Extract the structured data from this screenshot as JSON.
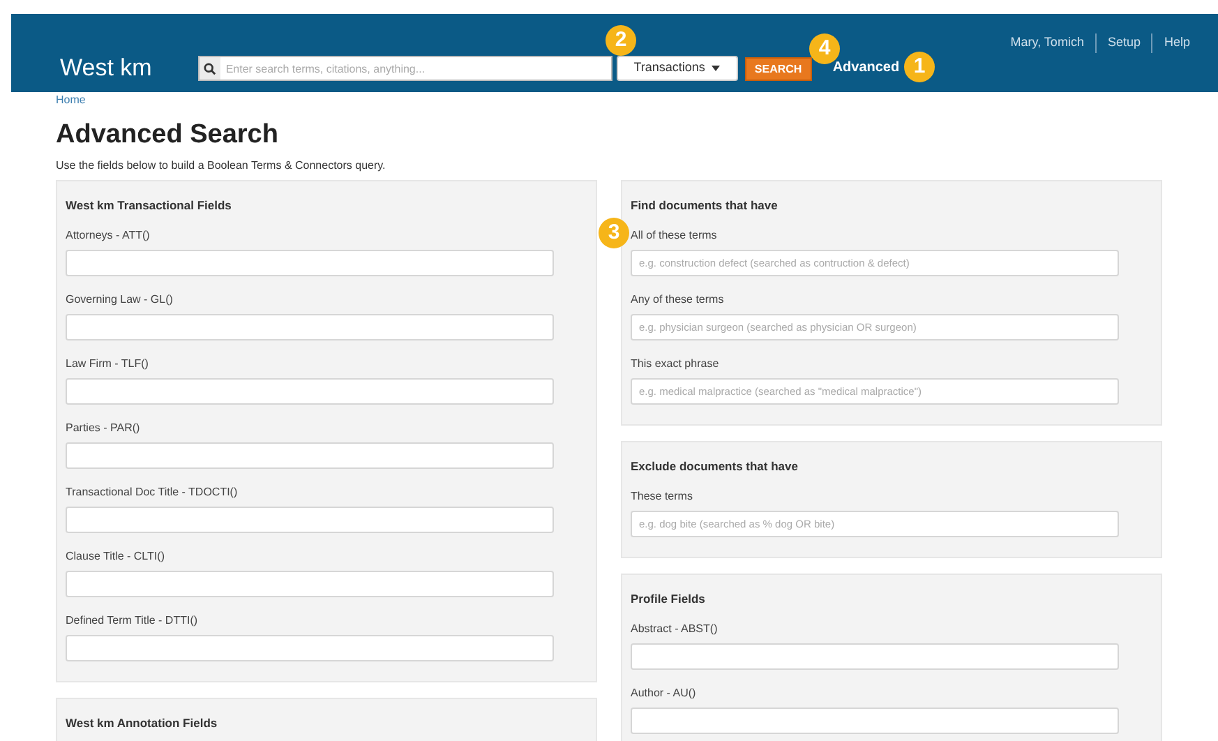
{
  "header": {
    "logo": "West km",
    "search": {
      "placeholder": "Enter search terms, citations, anything..."
    },
    "scope_button": "Transactions",
    "search_button": "SEARCH",
    "advanced_link": "Advanced",
    "user_links": [
      "Mary, Tomich",
      "Setup",
      "Help"
    ]
  },
  "breadcrumb": "Home",
  "title": "Advanced Search",
  "intro": "Use the fields below to build a Boolean Terms & Connectors query.",
  "left_panels": [
    {
      "heading": "West km Transactional Fields",
      "fields": [
        {
          "label": "Attorneys - ATT()"
        },
        {
          "label": "Governing Law - GL()"
        },
        {
          "label": "Law Firm - TLF()"
        },
        {
          "label": "Parties - PAR()"
        },
        {
          "label": "Transactional Doc Title - TDOCTI()"
        },
        {
          "label": "Clause Title - CLTI()"
        },
        {
          "label": "Defined Term Title - DTTI()"
        }
      ]
    },
    {
      "heading": "West km Annotation Fields"
    }
  ],
  "right_panels": [
    {
      "heading": "Find documents that have",
      "fields": [
        {
          "label": "All of these terms",
          "placeholder": "e.g. construction defect (searched as contruction & defect)"
        },
        {
          "label": "Any of these terms",
          "placeholder": "e.g. physician surgeon (searched as physician OR surgeon)"
        },
        {
          "label": "This exact phrase",
          "placeholder": "e.g. medical malpractice (searched as \"medical malpractice\")"
        }
      ]
    },
    {
      "heading": "Exclude documents that have",
      "fields": [
        {
          "label": "These terms",
          "placeholder": "e.g. dog bite (searched as % dog OR bite)"
        }
      ]
    },
    {
      "heading": "Profile Fields",
      "fields": [
        {
          "label": "Abstract - ABST()"
        },
        {
          "label": "Author - AU()"
        }
      ]
    }
  ],
  "callouts": [
    "2",
    "4",
    "1",
    "3"
  ]
}
